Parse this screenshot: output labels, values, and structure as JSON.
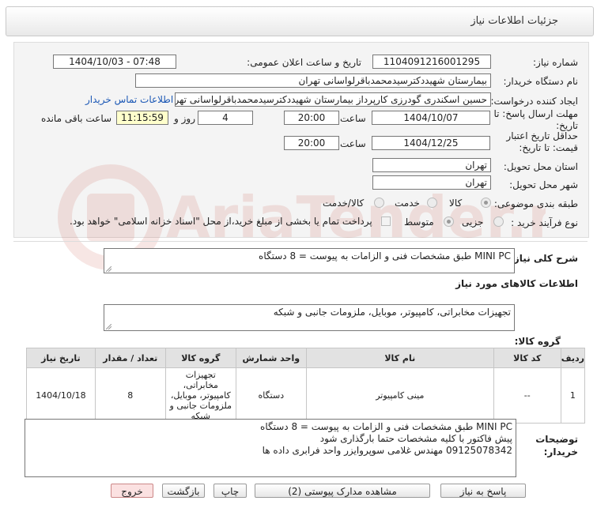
{
  "header": {
    "title": "جزئیات اطلاعات نیاز"
  },
  "form": {
    "need_number_label": "شماره نیاز:",
    "need_number": "1104091216001295",
    "announce_label": "تاریخ و ساعت اعلان عمومی:",
    "announce_value": "1404/10/03 - 07:48",
    "buyer_org_label": "نام دستگاه خریدار:",
    "buyer_org": "بیمارستان شهیددکترسیدمحمدباقرلواسانی تهران",
    "creator_label": "ایجاد کننده درخواست:",
    "creator": "حسین اسکندری گودرزی کارپرداز بیمارستان شهیددکترسیدمحمدباقرلواسانی تهران",
    "contact_link": "اطلاعات تماس خریدار",
    "deadline_label": "مهلت ارسال پاسخ: تا تاریخ:",
    "deadline_date": "1404/10/07",
    "time_label": "ساعت",
    "deadline_time": "20:00",
    "days_value": "4",
    "days_label": "روز و",
    "remaining_time": "11:15:59",
    "remaining_label": "ساعت باقی مانده",
    "validity_label": "حداقل تاریخ اعتبار قیمت: تا تاریخ:",
    "validity_date": "1404/12/25",
    "validity_time_label": "ساعت",
    "validity_time": "20:00",
    "province_label": "استان محل تحویل:",
    "province": "تهران",
    "city_label": "شهر محل تحویل:",
    "city": "تهران",
    "category_label": "طبقه بندی موضوعی:",
    "category_options": [
      "کالا",
      "خدمت",
      "کالا/خدمت"
    ],
    "process_label": "نوع فرآیند خرید :",
    "process_options": [
      "جزیی",
      "متوسط"
    ],
    "payment_note": "پرداخت تمام یا بخشی از مبلغ خرید،از محل \"اسناد خزانه اسلامی\" خواهد بود."
  },
  "summary": {
    "label": "شرح کلی نیاز:",
    "text": "MINI PC طبق مشخصات فنی و الزامات به پیوست = 8 دستگاه"
  },
  "goods": {
    "section_title": "اطلاعات کالاهای مورد نیاز",
    "group_label": "گروه کالا:",
    "group_text": "تجهیزات مخابراتی، کامپیوتر، موبایل، ملزومات جانبی و شبکه",
    "columns": [
      "ردیف",
      "کد کالا",
      "نام کالا",
      "واحد شمارش",
      "گروه کالا",
      "تعداد / مقدار",
      "تاریخ نیاز"
    ],
    "rows": [
      [
        "1",
        "--",
        "مینی کامپیوتر",
        "دستگاه",
        "تجهیزات مخابراتی، کامپیوتر، موبایل، ملزومات جانبی و شبکه",
        "8",
        "1404/10/18"
      ]
    ]
  },
  "notes": {
    "label": "توضیحات خریدار:",
    "lines": [
      "MINI PC طبق مشخصات فنی و الزامات به پیوست = 8 دستگاه",
      "پیش فاکتور با کلیه مشخصات حتما بارگذاری شود",
      "09125078342 مهندس غلامی سوپروایزر واحد فرابری داده ها"
    ]
  },
  "buttons": {
    "reply": "پاسخ به نیاز",
    "attachments": "مشاهده مدارک پیوستی (2)",
    "print": "چاپ",
    "back": "بازگشت",
    "exit": "خروج"
  },
  "watermark": {
    "text": "AriaTender.neT"
  },
  "colors": {
    "link": "#1a57b5",
    "remaining_bg": "#ffffcc",
    "exit_bg": "#fbe1e1"
  }
}
